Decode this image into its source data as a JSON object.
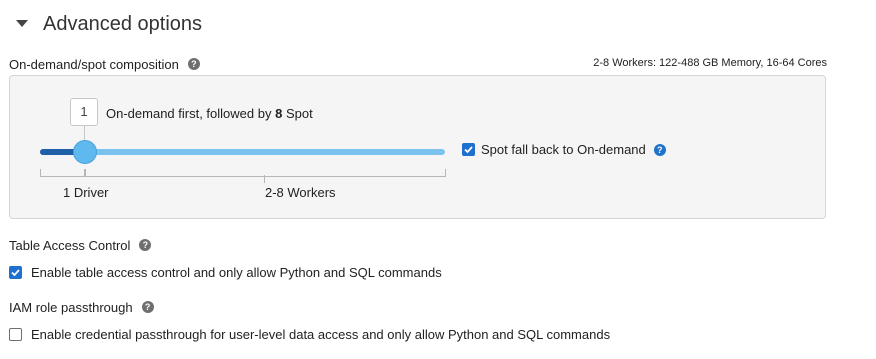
{
  "section": {
    "title": "Advanced options"
  },
  "composition": {
    "label": "On-demand/spot composition",
    "summary": "2-8 Workers: 122-488 GB Memory, 16-64 Cores",
    "ondemand_count": "1",
    "text_prefix": "On-demand first, followed by",
    "spot_count": "8",
    "text_suffix": "Spot",
    "driver_label": "1 Driver",
    "workers_label": "2-8 Workers",
    "slider_fraction": 0.11,
    "fallback": {
      "label": "Spot fall back to On-demand",
      "checked": true
    }
  },
  "table_access": {
    "heading": "Table Access Control",
    "checkbox_label": "Enable table access control and only allow Python and SQL commands",
    "checked": true
  },
  "iam": {
    "heading": "IAM role passthrough",
    "checkbox_label": "Enable credential passthrough for user-level data access and only allow Python and SQL commands",
    "checked": false
  },
  "colors": {
    "accent": "#1f6fcf",
    "slider_fill": "#1f5fa8",
    "slider_track": "#7cc2ef",
    "thumb": "#5fb8ee",
    "panel_bg": "#f5f5f5"
  }
}
